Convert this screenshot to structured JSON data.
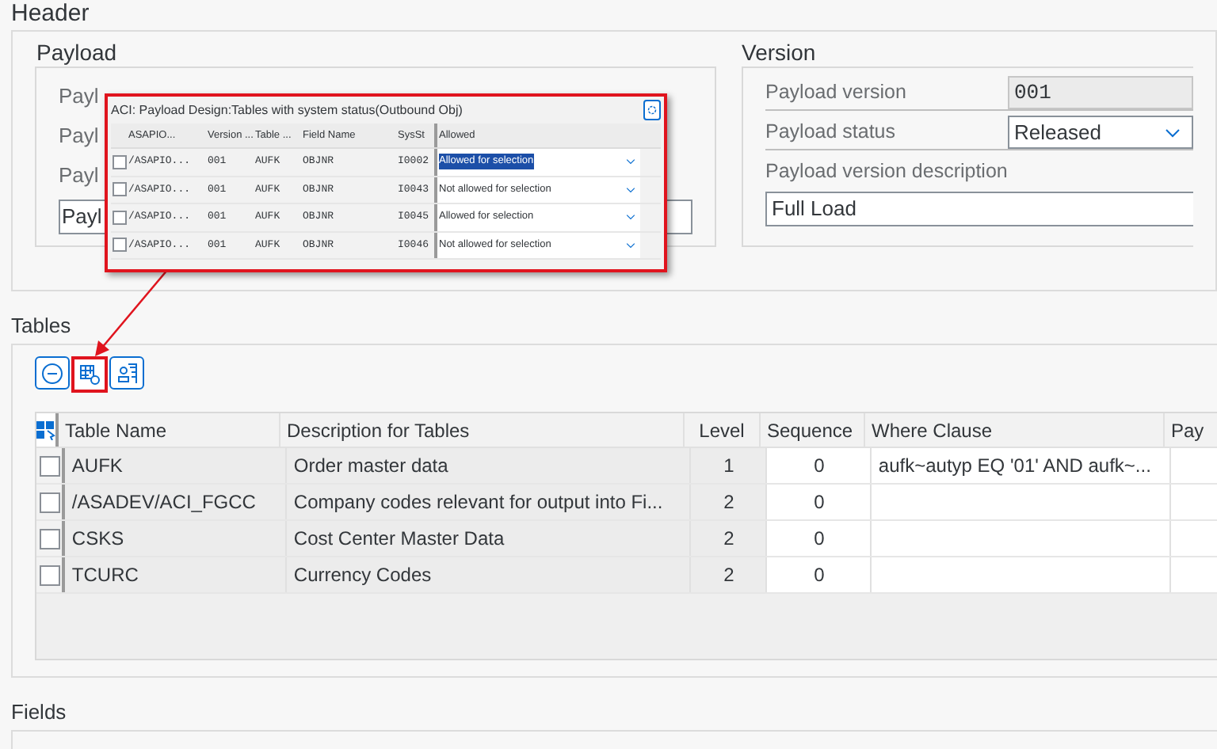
{
  "header": {
    "title": "Header"
  },
  "payload": {
    "title": "Payload",
    "labels": [
      "Payl",
      "Payl",
      "Payl"
    ],
    "field": "Payl"
  },
  "version": {
    "title": "Version",
    "rows": [
      {
        "label": "Payload version",
        "value": "001",
        "kind": "readonly"
      },
      {
        "label": "Payload status",
        "value": "Released",
        "kind": "dropdown"
      }
    ],
    "description_label": "Payload version description",
    "description_value": "Full Load"
  },
  "popup": {
    "title": "ACI: Payload Design:Tables with system status(Outbound Obj)",
    "columns": [
      "ASAPIO...",
      "Version ...",
      "Table ...",
      "Field Name",
      "SysSt",
      "Allowed"
    ],
    "rows": [
      {
        "cells": [
          "/ASAPIO...",
          "001",
          "AUFK",
          "OBJNR",
          "I0002"
        ],
        "allowed": "Allowed for selection",
        "selected": true,
        "checked": false
      },
      {
        "cells": [
          "/ASAPIO...",
          "001",
          "AUFK",
          "OBJNR",
          "I0043"
        ],
        "allowed": "Not allowed for selection",
        "selected": false,
        "checked": false
      },
      {
        "cells": [
          "/ASAPIO...",
          "001",
          "AUFK",
          "OBJNR",
          "I0045"
        ],
        "allowed": "Allowed for selection",
        "selected": false,
        "checked": false
      },
      {
        "cells": [
          "/ASAPIO...",
          "001",
          "AUFK",
          "OBJNR",
          "I0046"
        ],
        "allowed": "Not allowed for selection",
        "selected": false,
        "checked": false
      }
    ]
  },
  "tables": {
    "title": "Tables",
    "columns": [
      "Table Name",
      "Description for Tables",
      "Level",
      "Sequence",
      "Where Clause",
      "Pay"
    ],
    "rows": [
      {
        "cells": [
          "AUFK",
          "Order master data",
          "1",
          "0",
          "aufk~autyp EQ '01' AND aufk~..."
        ],
        "checked": false
      },
      {
        "cells": [
          "/ASADEV/ACI_FGCC",
          "Company codes relevant for output into Fi...",
          "2",
          "0",
          ""
        ],
        "checked": false
      },
      {
        "cells": [
          "CSKS",
          "Cost Center Master Data",
          "2",
          "0",
          ""
        ],
        "checked": false
      },
      {
        "cells": [
          "TCURC",
          "Currency Codes",
          "2",
          "0",
          ""
        ],
        "checked": false
      }
    ]
  },
  "fields": {
    "title": "Fields"
  }
}
